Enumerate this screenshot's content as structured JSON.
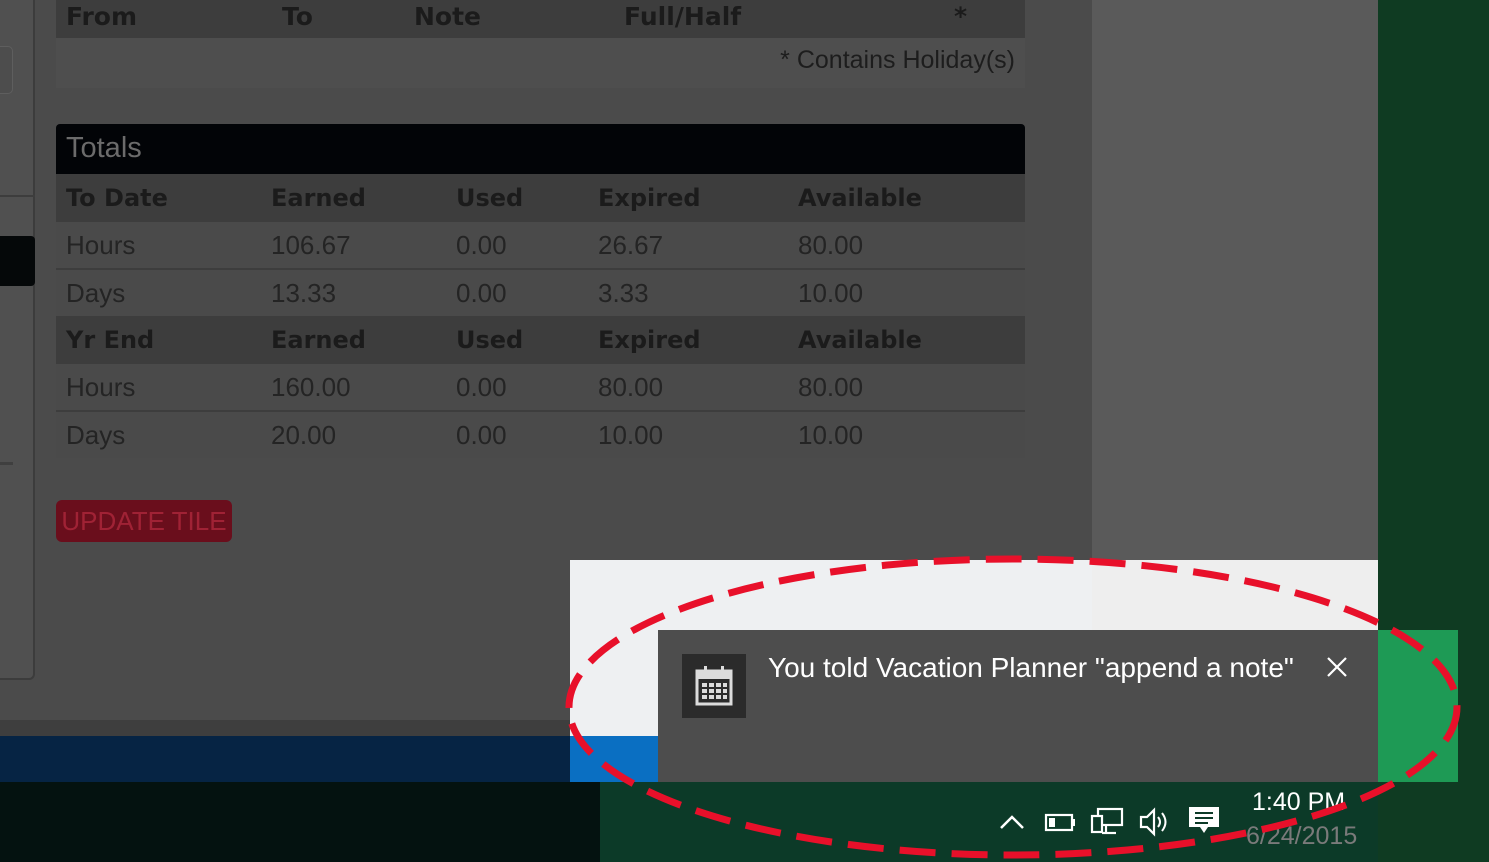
{
  "entries_header": {
    "from": "From",
    "to": "To",
    "note": "Note",
    "full_half": "Full/Half",
    "star": "*",
    "holiday_note": "* Contains Holiday(s)"
  },
  "totals": {
    "title": "Totals",
    "to_date": {
      "header": [
        "To Date",
        "Earned",
        "Used",
        "Expired",
        "Available"
      ],
      "rows": [
        [
          "Hours",
          "106.67",
          "0.00",
          "26.67",
          "80.00"
        ],
        [
          "Days",
          "13.33",
          "0.00",
          "3.33",
          "10.00"
        ]
      ]
    },
    "yr_end": {
      "header": [
        "Yr End",
        "Earned",
        "Used",
        "Expired",
        "Available"
      ],
      "rows": [
        [
          "Hours",
          "160.00",
          "0.00",
          "80.00",
          "80.00"
        ],
        [
          "Days",
          "20.00",
          "0.00",
          "10.00",
          "10.00"
        ]
      ]
    }
  },
  "update_button": "UPDATE TILE",
  "toast": {
    "message": "You told Vacation Planner \"append a note\"",
    "icon": "calendar-icon"
  },
  "tray": {
    "icons": [
      "chevron-up-icon",
      "battery-icon",
      "network-icon",
      "volume-icon",
      "action-center-icon"
    ],
    "time": "1:40 PM",
    "date": "6/24/2015"
  },
  "colors": {
    "highlight": "#e8102a",
    "update_button": "#6a0e1c"
  }
}
